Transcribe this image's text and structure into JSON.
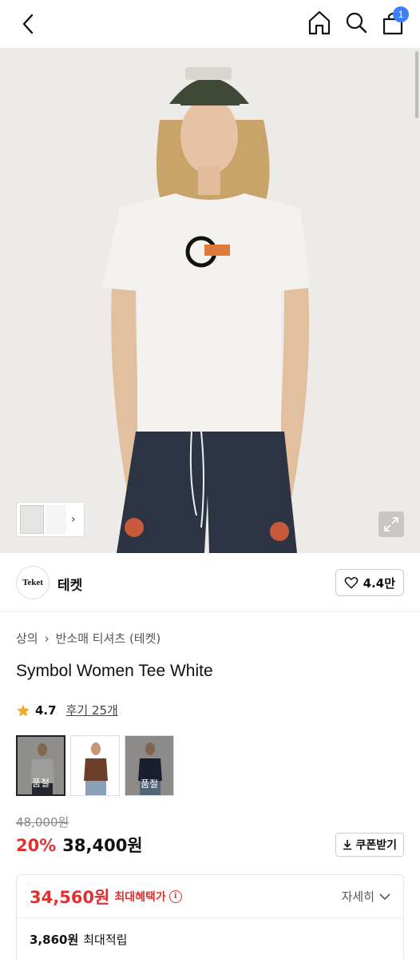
{
  "header": {
    "cart_count": "1"
  },
  "brand": {
    "logo_text": "Teket",
    "name": "테켓",
    "likes": "4.4만"
  },
  "breadcrumb": {
    "level1": "상의",
    "level2": "반소매 티셔츠 (테켓)"
  },
  "product": {
    "title": "Symbol Women Tee White",
    "rating": "4.7",
    "reviews": "후기 25개"
  },
  "colors": [
    {
      "label": "품절",
      "selected": true
    },
    {
      "label": "",
      "selected": false
    },
    {
      "label": "품절",
      "selected": false
    }
  ],
  "pricing": {
    "original": "48,000원",
    "discount": "20%",
    "price": "38,400원",
    "coupon_label": "쿠폰받기",
    "max_benefit_price": "34,560원",
    "max_benefit_label": "최대혜택가",
    "detail_label": "자세히",
    "points_value": "3,860원",
    "points_label": "최대적립"
  }
}
